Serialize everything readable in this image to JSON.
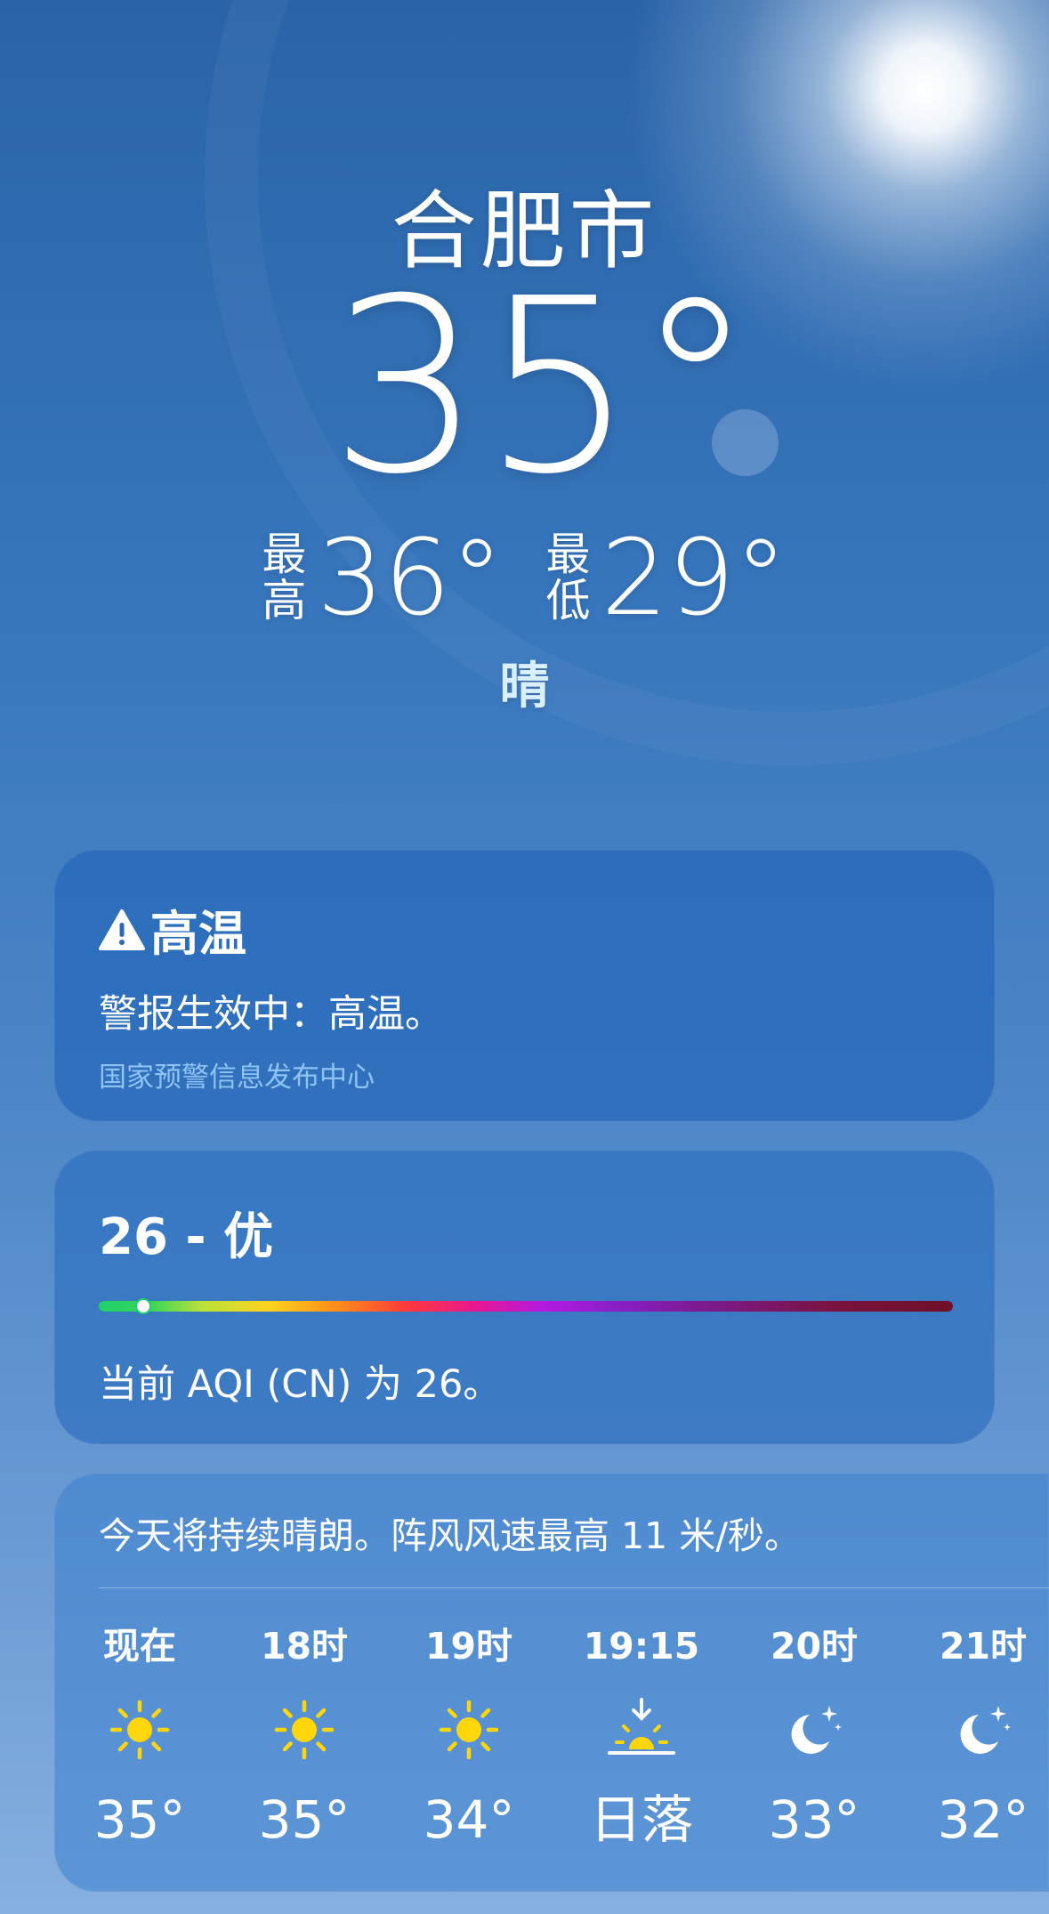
{
  "location": {
    "city": "合肥市",
    "temperature": "35°",
    "high_label": "最高",
    "high_value": "36°",
    "low_label": "最低",
    "low_value": "29°",
    "condition": "晴"
  },
  "alert": {
    "title": "高温",
    "icon": "warning-triangle-icon",
    "body": "警报生效中：高温。",
    "source": "国家预警信息发布中心"
  },
  "aqi": {
    "title": "26 - 优",
    "value": 26,
    "scale_max": 500,
    "description": "当前 AQI (CN) 为 26。"
  },
  "hourly": {
    "summary": "今天将持续晴朗。阵风风速最高 11 米/秒。",
    "items": [
      {
        "time": "现在",
        "icon": "sun-icon",
        "temp": "35°"
      },
      {
        "time": "18时",
        "icon": "sun-icon",
        "temp": "35°"
      },
      {
        "time": "19时",
        "icon": "sun-icon",
        "temp": "34°"
      },
      {
        "time": "19:15",
        "icon": "sunset-icon",
        "temp": "日落"
      },
      {
        "time": "20时",
        "icon": "moon-stars-icon",
        "temp": "33°"
      },
      {
        "time": "21时",
        "icon": "moon-stars-icon",
        "temp": "32°"
      }
    ]
  },
  "colors": {
    "sun_icon": "#ffd60a",
    "aqi_good": "#1fd16b",
    "alert_source": "#8fc3f4",
    "condition_text": "#d8f0ff"
  }
}
